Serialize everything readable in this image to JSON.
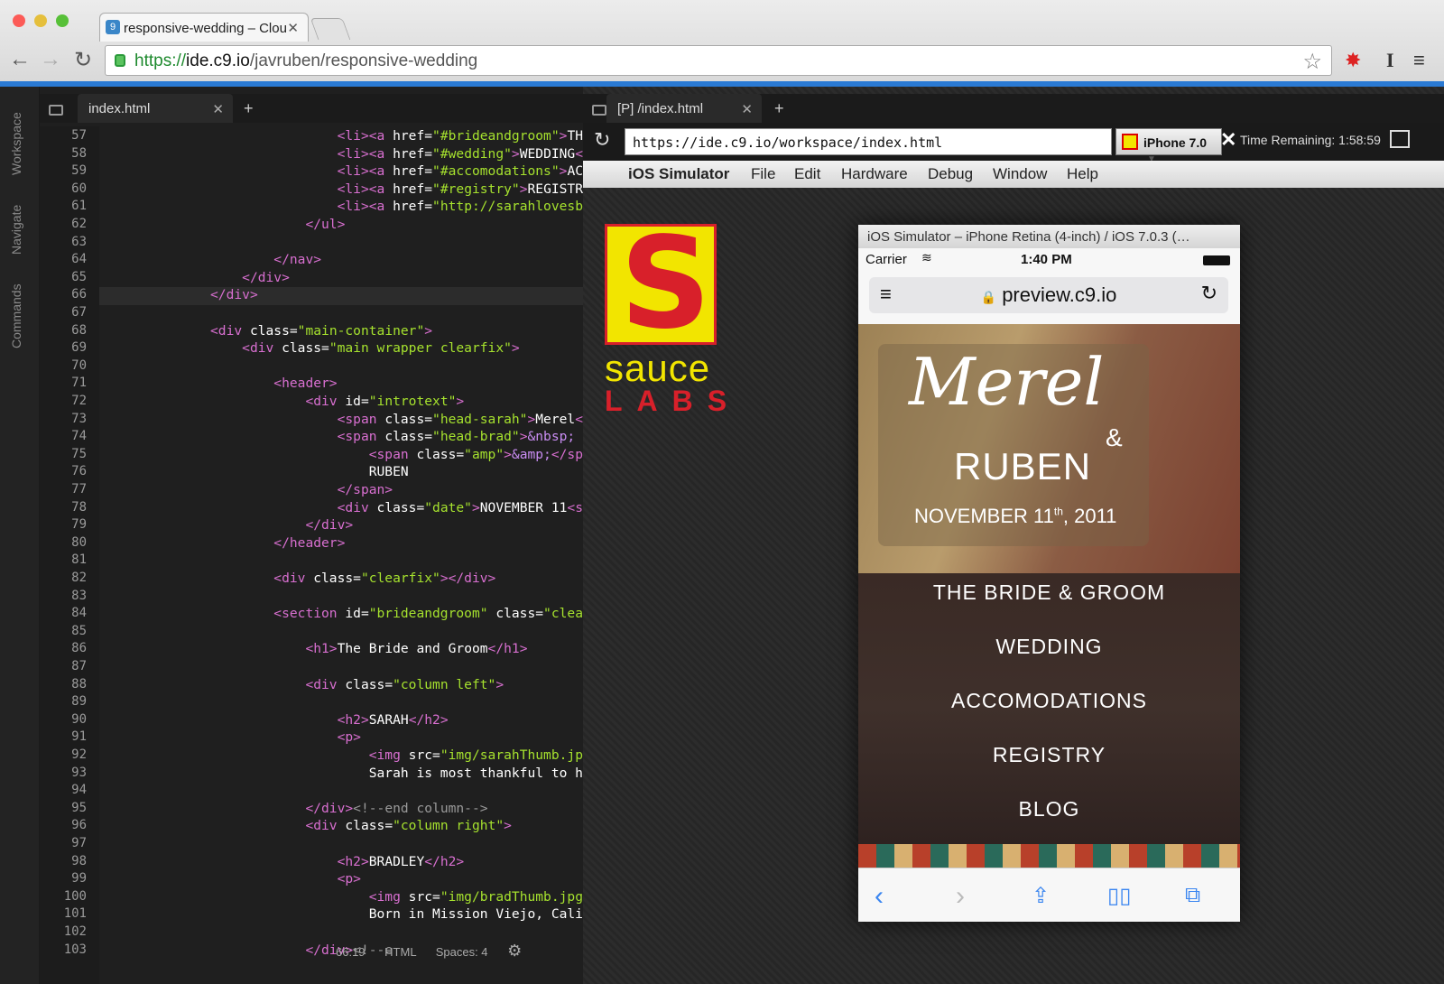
{
  "browser": {
    "tab_title": "responsive-wedding – Clou",
    "url_scheme": "https://",
    "url_host": "ide.c9.io",
    "url_path": "/javruben/responsive-wedding"
  },
  "sidebar": {
    "items": [
      "Workspace",
      "Navigate",
      "Commands"
    ]
  },
  "editor": {
    "tab_label": "index.html",
    "status_cursor": "66:19",
    "status_lang": "HTML",
    "status_spaces": "Spaces: 4",
    "line_numbers": [
      "57",
      "58",
      "59",
      "60",
      "61",
      "62",
      "63",
      "64",
      "65",
      "66",
      "67",
      "68",
      "69",
      "70",
      "71",
      "72",
      "73",
      "74",
      "75",
      "76",
      "77",
      "78",
      "79",
      "80",
      "81",
      "82",
      "83",
      "84",
      "85",
      "86",
      "87",
      "88",
      "89",
      "90",
      "91",
      "92",
      "93",
      "94",
      "95",
      "96",
      "97",
      "98",
      "99",
      "100",
      "101",
      "102",
      "103"
    ]
  },
  "preview": {
    "tab_label": "[P] /index.html",
    "url": "https://ide.c9.io/workspace/index.html",
    "device": "iPhone 7.0",
    "time_remaining": "Time Remaining: 1:58:59",
    "mac_menu": [
      "iOS Simulator",
      "File",
      "Edit",
      "Hardware",
      "Debug",
      "Window",
      "Help"
    ],
    "sauce_text": "sauce",
    "labs_text": "LABS",
    "phone": {
      "title": "iOS Simulator – iPhone Retina (4-inch) / iOS 7.0.3 (…",
      "carrier": "Carrier",
      "time": "1:40 PM",
      "address": "preview.c9.io",
      "hero_name1": "Merel",
      "hero_amp": "&",
      "hero_name2": "RUBEN",
      "hero_date_pre": "NOVEMBER 11",
      "hero_date_sup": "th",
      "hero_date_post": ", 2011",
      "menu": [
        "THE BRIDE & GROOM",
        "WEDDING",
        "ACCOMODATIONS",
        "REGISTRY",
        "BLOG"
      ]
    }
  },
  "code_lines": [
    {
      "indent": "                ",
      "parts": [
        [
          "t",
          "<li><a "
        ],
        [
          "a",
          "href="
        ],
        [
          "s",
          "\"#brideandgroom\""
        ],
        [
          "t",
          ">"
        ],
        [
          "a",
          "THE"
        ]
      ]
    },
    {
      "indent": "                ",
      "parts": [
        [
          "t",
          "<li><a "
        ],
        [
          "a",
          "href="
        ],
        [
          "s",
          "\"#wedding\""
        ],
        [
          "t",
          ">"
        ],
        [
          "a",
          "WEDDING"
        ],
        [
          "t",
          "</"
        ]
      ]
    },
    {
      "indent": "                ",
      "parts": [
        [
          "t",
          "<li><a "
        ],
        [
          "a",
          "href="
        ],
        [
          "s",
          "\"#accomodations\""
        ],
        [
          "t",
          ">"
        ],
        [
          "a",
          "ACC"
        ]
      ]
    },
    {
      "indent": "                ",
      "parts": [
        [
          "t",
          "<li><a "
        ],
        [
          "a",
          "href="
        ],
        [
          "s",
          "\"#registry\""
        ],
        [
          "t",
          ">"
        ],
        [
          "a",
          "REGISTRY"
        ],
        [
          "t",
          "<"
        ]
      ]
    },
    {
      "indent": "                ",
      "parts": [
        [
          "t",
          "<li><a "
        ],
        [
          "a",
          "href="
        ],
        [
          "s",
          "\"http://sarahlovesbr"
        ]
      ]
    },
    {
      "indent": "            ",
      "parts": [
        [
          "t",
          "</ul>"
        ]
      ]
    },
    {
      "indent": "",
      "parts": []
    },
    {
      "indent": "        ",
      "parts": [
        [
          "t",
          "</nav>"
        ]
      ]
    },
    {
      "indent": "    ",
      "parts": [
        [
          "t",
          "</div>"
        ]
      ]
    },
    {
      "indent": "",
      "parts": [
        [
          "t",
          "</div>"
        ]
      ]
    },
    {
      "indent": "",
      "parts": []
    },
    {
      "indent": "",
      "parts": [
        [
          "t",
          "<div "
        ],
        [
          "a",
          "class="
        ],
        [
          "s",
          "\"main-container\""
        ],
        [
          "t",
          ">"
        ]
      ]
    },
    {
      "indent": "    ",
      "parts": [
        [
          "t",
          "<div "
        ],
        [
          "a",
          "class="
        ],
        [
          "s",
          "\"main wrapper clearfix\""
        ],
        [
          "t",
          ">"
        ]
      ]
    },
    {
      "indent": "",
      "parts": []
    },
    {
      "indent": "        ",
      "parts": [
        [
          "t",
          "<header>"
        ]
      ]
    },
    {
      "indent": "            ",
      "parts": [
        [
          "t",
          "<div "
        ],
        [
          "a",
          "id="
        ],
        [
          "s",
          "\"introtext\""
        ],
        [
          "t",
          ">"
        ]
      ]
    },
    {
      "indent": "                ",
      "parts": [
        [
          "t",
          "<span "
        ],
        [
          "a",
          "class="
        ],
        [
          "s",
          "\"head-sarah\""
        ],
        [
          "t",
          ">"
        ],
        [
          "a",
          "Merel"
        ],
        [
          "t",
          "</s"
        ]
      ]
    },
    {
      "indent": "                ",
      "parts": [
        [
          "t",
          "<span "
        ],
        [
          "a",
          "class="
        ],
        [
          "s",
          "\"head-brad\""
        ],
        [
          "t",
          ">"
        ],
        [
          "e",
          "&nbsp;"
        ]
      ]
    },
    {
      "indent": "                    ",
      "parts": [
        [
          "t",
          "<span "
        ],
        [
          "a",
          "class="
        ],
        [
          "s",
          "\"amp\""
        ],
        [
          "t",
          ">"
        ],
        [
          "e",
          "&amp;"
        ],
        [
          "t",
          "</spar"
        ]
      ]
    },
    {
      "indent": "                    ",
      "parts": [
        [
          "a",
          "RUBEN"
        ]
      ]
    },
    {
      "indent": "                ",
      "parts": [
        [
          "t",
          "</span>"
        ]
      ]
    },
    {
      "indent": "                ",
      "parts": [
        [
          "t",
          "<div "
        ],
        [
          "a",
          "class="
        ],
        [
          "s",
          "\"date\""
        ],
        [
          "t",
          ">"
        ],
        [
          "a",
          "NOVEMBER 11"
        ],
        [
          "t",
          "<su"
        ]
      ]
    },
    {
      "indent": "            ",
      "parts": [
        [
          "t",
          "</div>"
        ]
      ]
    },
    {
      "indent": "        ",
      "parts": [
        [
          "t",
          "</header>"
        ]
      ]
    },
    {
      "indent": "",
      "parts": []
    },
    {
      "indent": "        ",
      "parts": [
        [
          "t",
          "<div "
        ],
        [
          "a",
          "class="
        ],
        [
          "s",
          "\"clearfix\""
        ],
        [
          "t",
          "></div>"
        ]
      ]
    },
    {
      "indent": "",
      "parts": []
    },
    {
      "indent": "        ",
      "parts": [
        [
          "t",
          "<section "
        ],
        [
          "a",
          "id="
        ],
        [
          "s",
          "\"brideandgroom\""
        ],
        [
          "a",
          " class="
        ],
        [
          "s",
          "\"clear"
        ]
      ]
    },
    {
      "indent": "",
      "parts": []
    },
    {
      "indent": "            ",
      "parts": [
        [
          "t",
          "<h1>"
        ],
        [
          "a",
          "The Bride and Groom"
        ],
        [
          "t",
          "</h1>"
        ]
      ]
    },
    {
      "indent": "",
      "parts": []
    },
    {
      "indent": "            ",
      "parts": [
        [
          "t",
          "<div "
        ],
        [
          "a",
          "class="
        ],
        [
          "s",
          "\"column left\""
        ],
        [
          "t",
          ">"
        ]
      ]
    },
    {
      "indent": "",
      "parts": []
    },
    {
      "indent": "                ",
      "parts": [
        [
          "t",
          "<h2>"
        ],
        [
          "a",
          "SARAH"
        ],
        [
          "t",
          "</h2>"
        ]
      ]
    },
    {
      "indent": "                ",
      "parts": [
        [
          "t",
          "<p>"
        ]
      ]
    },
    {
      "indent": "                    ",
      "parts": [
        [
          "t",
          "<img "
        ],
        [
          "a",
          "src="
        ],
        [
          "s",
          "\"img/sarahThumb.jpg\""
        ]
      ]
    },
    {
      "indent": "                    ",
      "parts": [
        [
          "a",
          "Sarah is most thankful to her"
        ]
      ]
    },
    {
      "indent": "",
      "parts": []
    },
    {
      "indent": "            ",
      "parts": [
        [
          "t",
          "</div>"
        ],
        [
          "c",
          "<!--end column-->"
        ]
      ]
    },
    {
      "indent": "            ",
      "parts": [
        [
          "t",
          "<div "
        ],
        [
          "a",
          "class="
        ],
        [
          "s",
          "\"column right\""
        ],
        [
          "t",
          ">"
        ]
      ]
    },
    {
      "indent": "",
      "parts": []
    },
    {
      "indent": "                ",
      "parts": [
        [
          "t",
          "<h2>"
        ],
        [
          "a",
          "BRADLEY"
        ],
        [
          "t",
          "</h2>"
        ]
      ]
    },
    {
      "indent": "                ",
      "parts": [
        [
          "t",
          "<p>"
        ]
      ]
    },
    {
      "indent": "                    ",
      "parts": [
        [
          "t",
          "<img "
        ],
        [
          "a",
          "src="
        ],
        [
          "s",
          "\"img/bradThumb.jpg\""
        ]
      ]
    },
    {
      "indent": "                    ",
      "parts": [
        [
          "a",
          "Born in Mission Viejo, Calif"
        ]
      ]
    },
    {
      "indent": "",
      "parts": []
    },
    {
      "indent": "            ",
      "parts": [
        [
          "t",
          "</div>"
        ],
        [
          "c",
          "<!--e"
        ]
      ]
    }
  ]
}
